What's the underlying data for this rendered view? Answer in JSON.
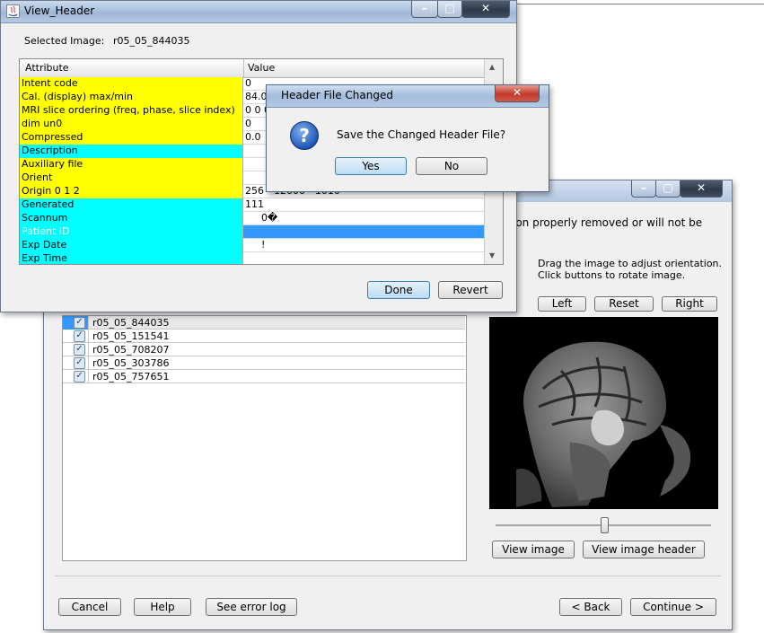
{
  "view_header": {
    "title": "View_Header",
    "selected_label": "Selected Image:",
    "selected_value": "r05_05_844035",
    "col_attribute": "Attribute",
    "col_value": "Value",
    "rows": [
      {
        "attr": "Intent code",
        "value": "0",
        "color": "yellow"
      },
      {
        "attr": "Cal. (display) max/min",
        "value": "84.0",
        "color": "yellow"
      },
      {
        "attr": "MRI slice ordering (freq, phase, slice index)",
        "value": "0 0 0",
        "color": "yellow"
      },
      {
        "attr": "dim un0",
        "value": "0",
        "color": "yellow"
      },
      {
        "attr": "Compressed",
        "value": "0.0",
        "color": "yellow"
      },
      {
        "attr": "Description",
        "value": "",
        "color": "cyan"
      },
      {
        "attr": "Auxiliary file",
        "value": "",
        "color": "yellow"
      },
      {
        "attr": "Orient",
        "value": "",
        "color": "yellow"
      },
      {
        "attr": "Origin 0 1 2",
        "value": "256 - 12000 - 1010",
        "color": "yellow"
      },
      {
        "attr": "Generated",
        "value": "111",
        "color": "cyan"
      },
      {
        "attr": "Scannum",
        "value": "0�",
        "color": "cyan"
      },
      {
        "attr": "Patient ID",
        "value": "",
        "color": "cyan-selected"
      },
      {
        "attr": "Exp Date",
        "value": "!",
        "color": "cyan"
      },
      {
        "attr": "Exp Time",
        "value": "",
        "color": "cyan"
      }
    ],
    "done_label": "Done",
    "revert_label": "Revert"
  },
  "confirm": {
    "title": "Header File Changed",
    "message": "Save the Changed Header File?",
    "yes_label": "Yes",
    "no_label": "No"
  },
  "wizard": {
    "partial_message": "ion properly removed or will not be",
    "drag_hint_1": "Drag the image to adjust orientation.",
    "drag_hint_2": "Click buttons to rotate image.",
    "left_label": "Left",
    "reset_label": "Reset",
    "right_label": "Right",
    "view_image_label": "View image",
    "view_header_label": "View image header",
    "images": [
      {
        "name": "r05_05_844035",
        "checked": true,
        "selected": true
      },
      {
        "name": "r05_05_151541",
        "checked": true,
        "selected": false
      },
      {
        "name": "r05_05_708207",
        "checked": true,
        "selected": false
      },
      {
        "name": "r05_05_303786",
        "checked": true,
        "selected": false
      },
      {
        "name": "r05_05_757651",
        "checked": true,
        "selected": false
      }
    ],
    "cancel_label": "Cancel",
    "help_label": "Help",
    "error_log_label": "See error log",
    "back_label": "< Back",
    "continue_label": "Continue >"
  },
  "icons": {
    "question": "?",
    "check": "✓"
  },
  "colors": {
    "row_yellow": "#ffff00",
    "row_cyan": "#00ffff",
    "selection_blue": "#3399ff"
  }
}
